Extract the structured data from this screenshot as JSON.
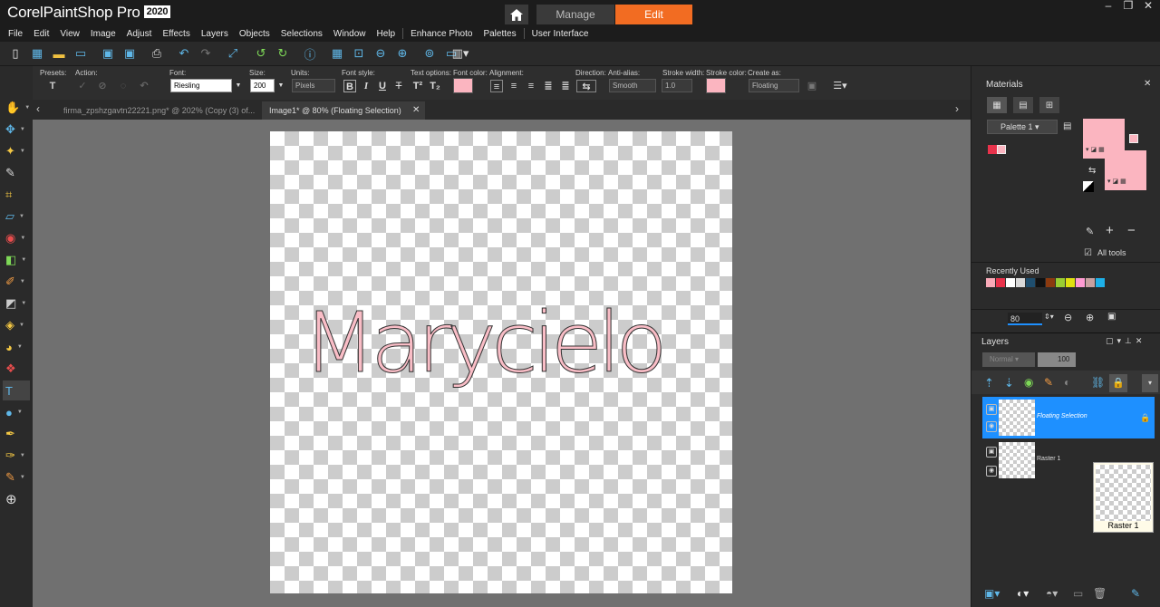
{
  "app": {
    "brand": "Corel",
    "product": "PaintShop Pro",
    "year": "2020"
  },
  "workspace_tabs": {
    "manage": "Manage",
    "edit": "Edit"
  },
  "menu": [
    "File",
    "Edit",
    "View",
    "Image",
    "Adjust",
    "Effects",
    "Layers",
    "Objects",
    "Selections",
    "Window",
    "Help",
    "Enhance Photo",
    "Palettes",
    "User Interface"
  ],
  "tool_options": {
    "presets": "Presets:",
    "action": "Action:",
    "font_label": "Font:",
    "font": "Riesling",
    "size_label": "Size:",
    "size": "200",
    "units_label": "Units:",
    "units": "Pixels",
    "font_style": "Font style:",
    "text_options": "Text options:",
    "font_color": "Font color:",
    "alignment": "Alignment:",
    "direction": "Direction:",
    "antialias_label": "Anti-alias:",
    "antialias": "Smooth",
    "stroke_width_label": "Stroke width:",
    "stroke_width": "1.0",
    "stroke_color": "Stroke color:",
    "create_as_label": "Create as:",
    "create_as": "Floating",
    "bold": "B",
    "italic": "I",
    "underline": "U",
    "strike": "T"
  },
  "doc_tabs": [
    {
      "label": "firma_zpshzgavtn22221.png* @ 202% (Copy (3) of..."
    },
    {
      "label": "Image1* @  80% (Floating Selection)"
    }
  ],
  "canvas_text": "Marycielo",
  "materials": {
    "title": "Materials",
    "palette": "Palette 1",
    "all_tools": "All tools",
    "recently_used": "Recently Used",
    "opacity": "80",
    "recent_colors": [
      "#f9aab8",
      "#e8324b",
      "#ffffff",
      "#d9d9d9",
      "#1f4e6e",
      "#111111",
      "#8b3a0f",
      "#9acd32",
      "#e0e010",
      "#ff9bd2",
      "#c8a0a0",
      "#1eb0e8"
    ]
  },
  "layers": {
    "title": "Layers",
    "blend": "Normal",
    "opacity": "100",
    "items": [
      {
        "name": "Floating Selection",
        "selected": true
      },
      {
        "name": "Raster 1",
        "selected": false
      }
    ],
    "preview_label": "Raster 1"
  },
  "colors": {
    "accent": "#f26c22",
    "selection": "#1e90ff",
    "font_color": "#fbb5c0"
  }
}
